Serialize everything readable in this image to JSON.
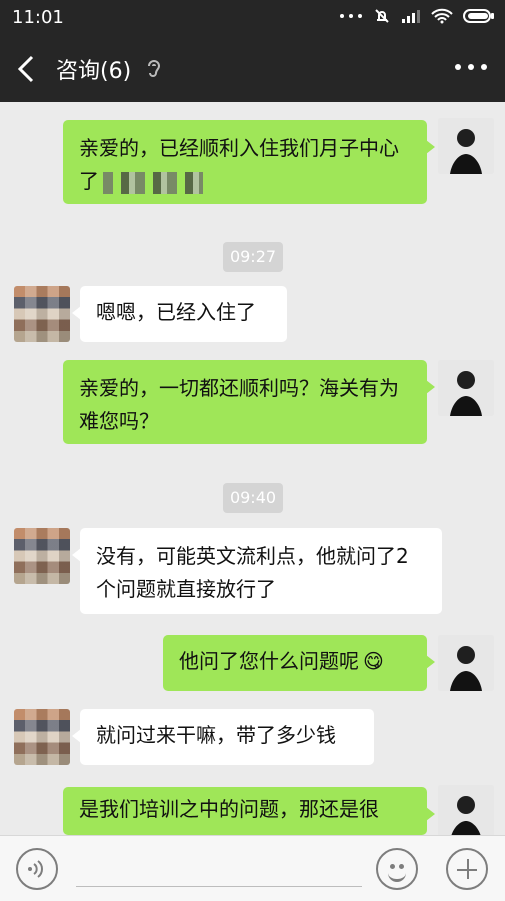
{
  "status_bar": {
    "time": "11:01",
    "icons": [
      "more-dots-icon",
      "mute-bell-icon",
      "signal-icon",
      "wifi-icon",
      "battery-icon"
    ]
  },
  "header": {
    "title": "咨询(6)",
    "icons": [
      "back-arrow-icon",
      "ear-icon",
      "more-icon"
    ]
  },
  "messages": [
    {
      "sender": "agent",
      "text": "亲爱的，已经顺利入住我们月子中心了"
    },
    {
      "sender": "time",
      "text": "09:27"
    },
    {
      "sender": "user",
      "text": "嗯嗯，已经入住了"
    },
    {
      "sender": "agent",
      "text": "亲爱的，一切都还顺利吗？海关有为难您吗？"
    },
    {
      "sender": "time",
      "text": "09:40"
    },
    {
      "sender": "user",
      "text": "没有，可能英文流利点，他就问了2个问题就直接放行了"
    },
    {
      "sender": "agent",
      "text": "他问了您什么问题呢",
      "emoji": "😋"
    },
    {
      "sender": "user",
      "text": "就问过来干嘛，带了多少钱"
    },
    {
      "sender": "agent",
      "text": "是我们培训之中的问题，那还是很"
    }
  ],
  "bottom_bar": {
    "icons": [
      "voice-icon",
      "emoji-icon",
      "plus-icon"
    ]
  },
  "colors": {
    "outgoing_bubble": "#9fe658",
    "incoming_bubble": "#ffffff",
    "bar": "#262626",
    "chat_bg": "#ebebeb"
  }
}
